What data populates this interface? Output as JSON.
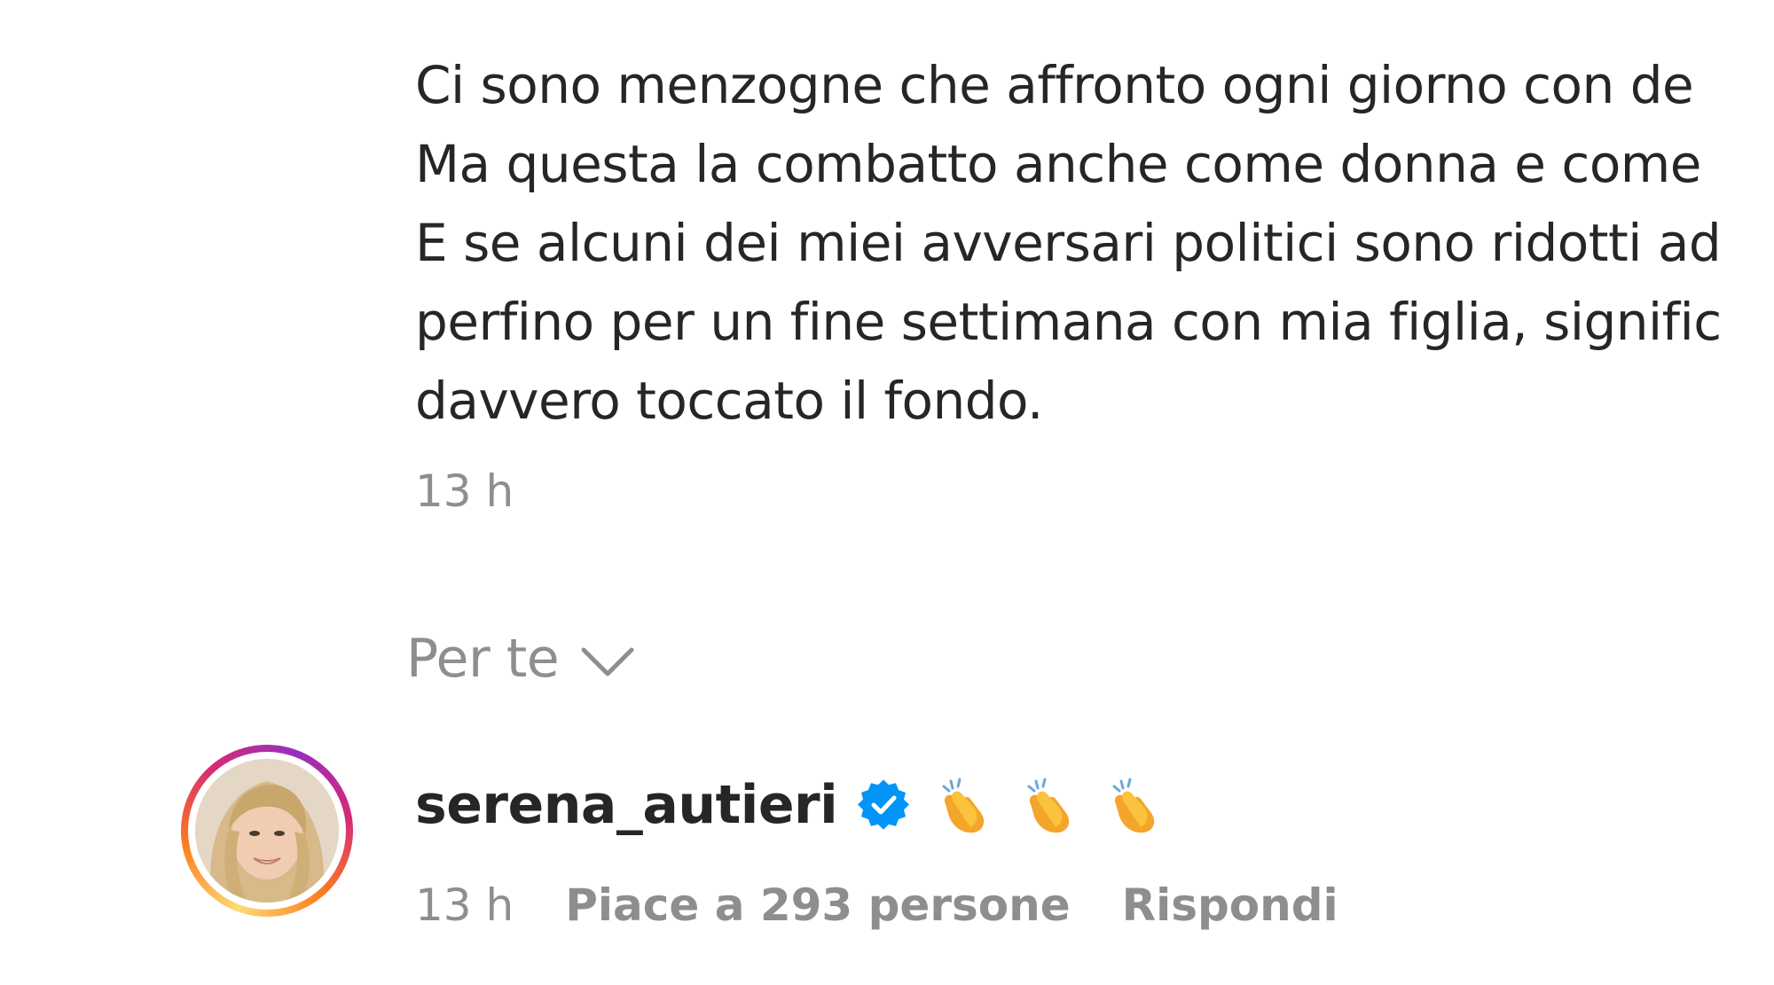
{
  "post": {
    "lines": [
      "Ci sono menzogne che affronto ogni giorno con de",
      "Ma questa la combatto anche come donna e come",
      "E se alcuni dei miei avversari politici sono ridotti ad",
      "perfino per un fine settimana con mia figlia, signific",
      "davvero toccato il fondo."
    ],
    "time": "13 h"
  },
  "sort": {
    "label": "Per te",
    "icon": "chevron-down-icon"
  },
  "comment": {
    "username": "serena_autieri",
    "verified_icon": "verified-badge-icon",
    "emojis": [
      "clapping-hands-icon",
      "clapping-hands-icon",
      "clapping-hands-icon"
    ],
    "time": "13 h",
    "likes": "Piace a 293 persone",
    "reply": "Rispondi"
  },
  "colors": {
    "text": "#262626",
    "muted": "#8e8e8e",
    "verified": "#0095f6"
  }
}
